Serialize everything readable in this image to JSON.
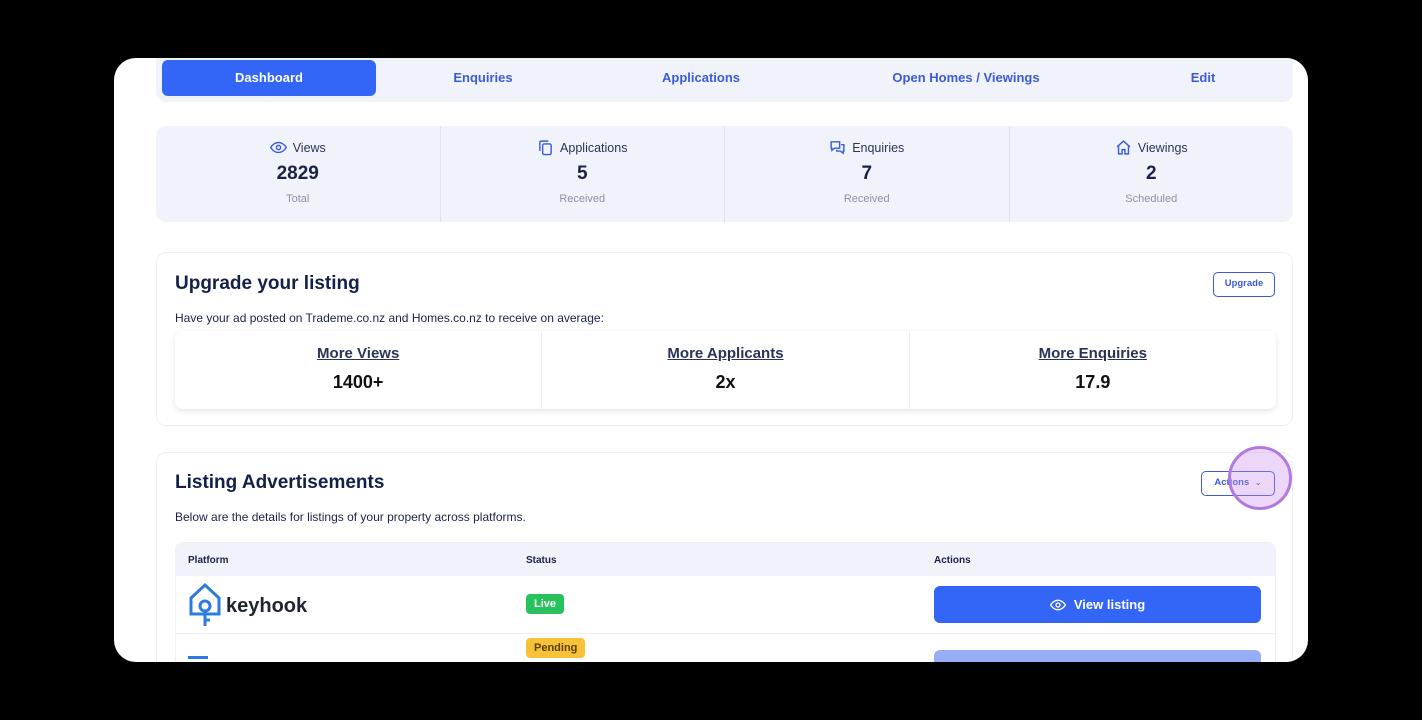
{
  "tabs": [
    {
      "label": "Dashboard",
      "active": true
    },
    {
      "label": "Enquiries"
    },
    {
      "label": "Applications"
    },
    {
      "label": "Open Homes / Viewings"
    },
    {
      "label": "Edit"
    }
  ],
  "stats": [
    {
      "icon": "eye-icon",
      "label": "Views",
      "value": "2829",
      "sub": "Total"
    },
    {
      "icon": "copy-icon",
      "label": "Applications",
      "value": "5",
      "sub": "Received"
    },
    {
      "icon": "chat-icon",
      "label": "Enquiries",
      "value": "7",
      "sub": "Received"
    },
    {
      "icon": "home-icon",
      "label": "Viewings",
      "value": "2",
      "sub": "Scheduled"
    }
  ],
  "upgrade": {
    "title": "Upgrade your listing",
    "description": "Have your ad posted on Trademe.co.nz and Homes.co.nz to receive on average:",
    "button": "Upgrade",
    "metrics": [
      {
        "label": "More Views",
        "value": "1400+"
      },
      {
        "label": "More Applicants",
        "value": "2x"
      },
      {
        "label": "More Enquiries",
        "value": "17.9"
      }
    ]
  },
  "ads": {
    "title": "Listing Advertisements",
    "description": "Below are the details for listings of your property across platforms.",
    "actions_button": "Actions",
    "columns": {
      "platform": "Platform",
      "status": "Status",
      "actions": "Actions"
    },
    "rows": [
      {
        "platform": "keyhook",
        "status": "Live",
        "action": "View listing"
      },
      {
        "platform": "",
        "status": "Pending",
        "action": ""
      }
    ]
  },
  "colors": {
    "primary": "#3365f6",
    "live": "#27c25b",
    "pending": "#f8c13a"
  }
}
